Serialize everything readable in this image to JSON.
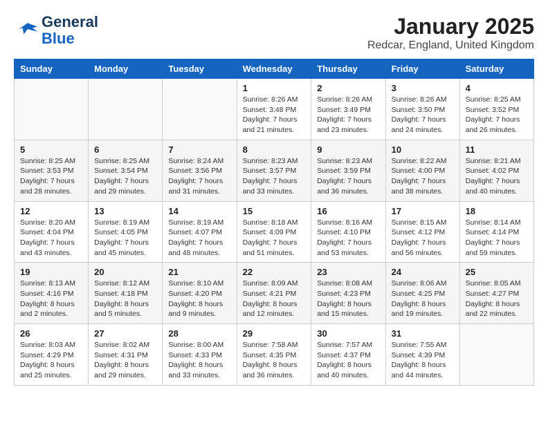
{
  "header": {
    "logo_general": "General",
    "logo_blue": "Blue",
    "month_title": "January 2025",
    "location": "Redcar, England, United Kingdom"
  },
  "weekdays": [
    "Sunday",
    "Monday",
    "Tuesday",
    "Wednesday",
    "Thursday",
    "Friday",
    "Saturday"
  ],
  "weeks": [
    [
      {
        "day": "",
        "info": ""
      },
      {
        "day": "",
        "info": ""
      },
      {
        "day": "",
        "info": ""
      },
      {
        "day": "1",
        "info": "Sunrise: 8:26 AM\nSunset: 3:48 PM\nDaylight: 7 hours\nand 21 minutes."
      },
      {
        "day": "2",
        "info": "Sunrise: 8:26 AM\nSunset: 3:49 PM\nDaylight: 7 hours\nand 23 minutes."
      },
      {
        "day": "3",
        "info": "Sunrise: 8:26 AM\nSunset: 3:50 PM\nDaylight: 7 hours\nand 24 minutes."
      },
      {
        "day": "4",
        "info": "Sunrise: 8:25 AM\nSunset: 3:52 PM\nDaylight: 7 hours\nand 26 minutes."
      }
    ],
    [
      {
        "day": "5",
        "info": "Sunrise: 8:25 AM\nSunset: 3:53 PM\nDaylight: 7 hours\nand 28 minutes."
      },
      {
        "day": "6",
        "info": "Sunrise: 8:25 AM\nSunset: 3:54 PM\nDaylight: 7 hours\nand 29 minutes."
      },
      {
        "day": "7",
        "info": "Sunrise: 8:24 AM\nSunset: 3:56 PM\nDaylight: 7 hours\nand 31 minutes."
      },
      {
        "day": "8",
        "info": "Sunrise: 8:23 AM\nSunset: 3:57 PM\nDaylight: 7 hours\nand 33 minutes."
      },
      {
        "day": "9",
        "info": "Sunrise: 8:23 AM\nSunset: 3:59 PM\nDaylight: 7 hours\nand 36 minutes."
      },
      {
        "day": "10",
        "info": "Sunrise: 8:22 AM\nSunset: 4:00 PM\nDaylight: 7 hours\nand 38 minutes."
      },
      {
        "day": "11",
        "info": "Sunrise: 8:21 AM\nSunset: 4:02 PM\nDaylight: 7 hours\nand 40 minutes."
      }
    ],
    [
      {
        "day": "12",
        "info": "Sunrise: 8:20 AM\nSunset: 4:04 PM\nDaylight: 7 hours\nand 43 minutes."
      },
      {
        "day": "13",
        "info": "Sunrise: 8:19 AM\nSunset: 4:05 PM\nDaylight: 7 hours\nand 45 minutes."
      },
      {
        "day": "14",
        "info": "Sunrise: 8:19 AM\nSunset: 4:07 PM\nDaylight: 7 hours\nand 48 minutes."
      },
      {
        "day": "15",
        "info": "Sunrise: 8:18 AM\nSunset: 4:09 PM\nDaylight: 7 hours\nand 51 minutes."
      },
      {
        "day": "16",
        "info": "Sunrise: 8:16 AM\nSunset: 4:10 PM\nDaylight: 7 hours\nand 53 minutes."
      },
      {
        "day": "17",
        "info": "Sunrise: 8:15 AM\nSunset: 4:12 PM\nDaylight: 7 hours\nand 56 minutes."
      },
      {
        "day": "18",
        "info": "Sunrise: 8:14 AM\nSunset: 4:14 PM\nDaylight: 7 hours\nand 59 minutes."
      }
    ],
    [
      {
        "day": "19",
        "info": "Sunrise: 8:13 AM\nSunset: 4:16 PM\nDaylight: 8 hours\nand 2 minutes."
      },
      {
        "day": "20",
        "info": "Sunrise: 8:12 AM\nSunset: 4:18 PM\nDaylight: 8 hours\nand 5 minutes."
      },
      {
        "day": "21",
        "info": "Sunrise: 8:10 AM\nSunset: 4:20 PM\nDaylight: 8 hours\nand 9 minutes."
      },
      {
        "day": "22",
        "info": "Sunrise: 8:09 AM\nSunset: 4:21 PM\nDaylight: 8 hours\nand 12 minutes."
      },
      {
        "day": "23",
        "info": "Sunrise: 8:08 AM\nSunset: 4:23 PM\nDaylight: 8 hours\nand 15 minutes."
      },
      {
        "day": "24",
        "info": "Sunrise: 8:06 AM\nSunset: 4:25 PM\nDaylight: 8 hours\nand 19 minutes."
      },
      {
        "day": "25",
        "info": "Sunrise: 8:05 AM\nSunset: 4:27 PM\nDaylight: 8 hours\nand 22 minutes."
      }
    ],
    [
      {
        "day": "26",
        "info": "Sunrise: 8:03 AM\nSunset: 4:29 PM\nDaylight: 8 hours\nand 25 minutes."
      },
      {
        "day": "27",
        "info": "Sunrise: 8:02 AM\nSunset: 4:31 PM\nDaylight: 8 hours\nand 29 minutes."
      },
      {
        "day": "28",
        "info": "Sunrise: 8:00 AM\nSunset: 4:33 PM\nDaylight: 8 hours\nand 33 minutes."
      },
      {
        "day": "29",
        "info": "Sunrise: 7:58 AM\nSunset: 4:35 PM\nDaylight: 8 hours\nand 36 minutes."
      },
      {
        "day": "30",
        "info": "Sunrise: 7:57 AM\nSunset: 4:37 PM\nDaylight: 8 hours\nand 40 minutes."
      },
      {
        "day": "31",
        "info": "Sunrise: 7:55 AM\nSunset: 4:39 PM\nDaylight: 8 hours\nand 44 minutes."
      },
      {
        "day": "",
        "info": ""
      }
    ]
  ]
}
